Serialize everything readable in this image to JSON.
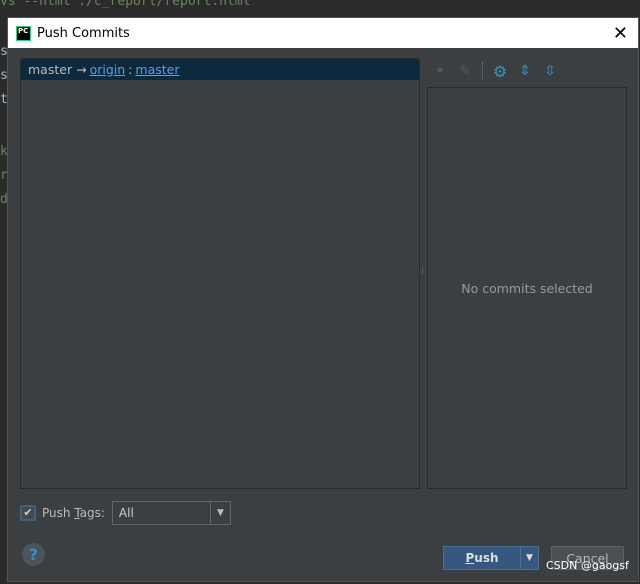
{
  "background": {
    "editor_line": "vs --html ./c_report/report.html",
    "edge_chars": [
      "s",
      "s",
      "t",
      "k",
      "r",
      "d"
    ]
  },
  "dialog": {
    "title": "Push Commits",
    "logo": "PC",
    "branch_row": {
      "local": "master",
      "arrow": "→",
      "remote": "origin",
      "sep": ":",
      "remote_branch": "master"
    },
    "toolbar": [
      "merge-icon",
      "edit-source-icon",
      "gear-icon",
      "expand-all-icon",
      "collapse-all-icon"
    ],
    "empty_text": "No commits selected",
    "push_tags": {
      "checked": true,
      "label_pre": "Push ",
      "label_mnemonic": "T",
      "label_post": "ags:",
      "value": "All"
    },
    "buttons": {
      "push_mnemonic": "P",
      "push_rest": "ush",
      "cancel": "Cancel"
    },
    "colors": {
      "accent": "#365880",
      "link": "#589df6",
      "selection": "#0d293e"
    }
  },
  "watermark": "CSDN @gaogsf"
}
